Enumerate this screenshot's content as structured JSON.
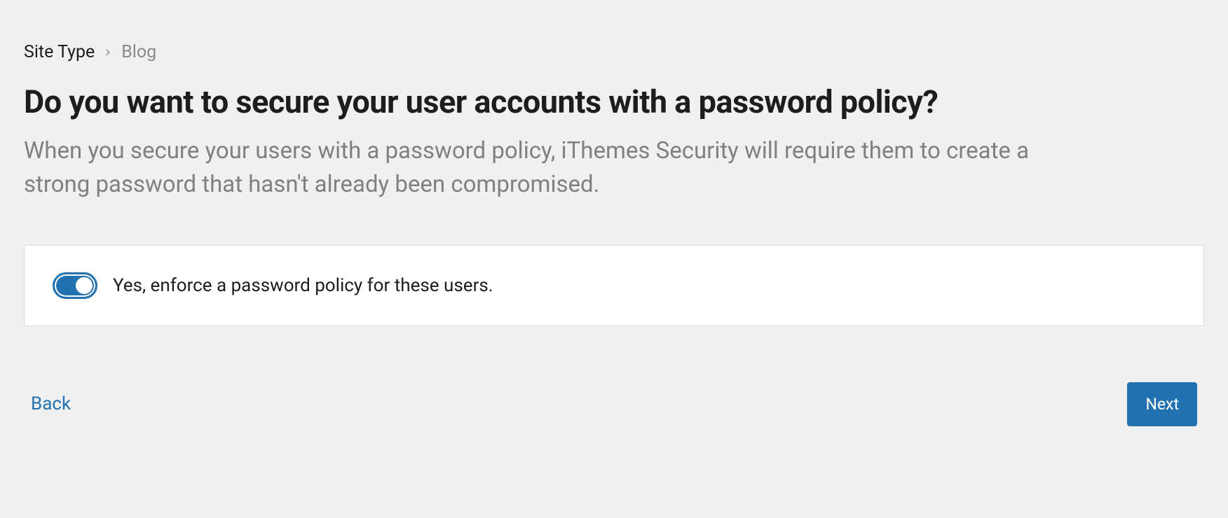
{
  "breadcrumb": {
    "parent": "Site Type",
    "current": "Blog"
  },
  "title": "Do you want to secure your user accounts with a password policy?",
  "description": "When you secure your users with a password policy, iThemes Security will require them to create a strong password that hasn't already been compromised.",
  "option": {
    "label": "Yes, enforce a password policy for these users.",
    "enabled": true
  },
  "nav": {
    "back": "Back",
    "next": "Next"
  }
}
